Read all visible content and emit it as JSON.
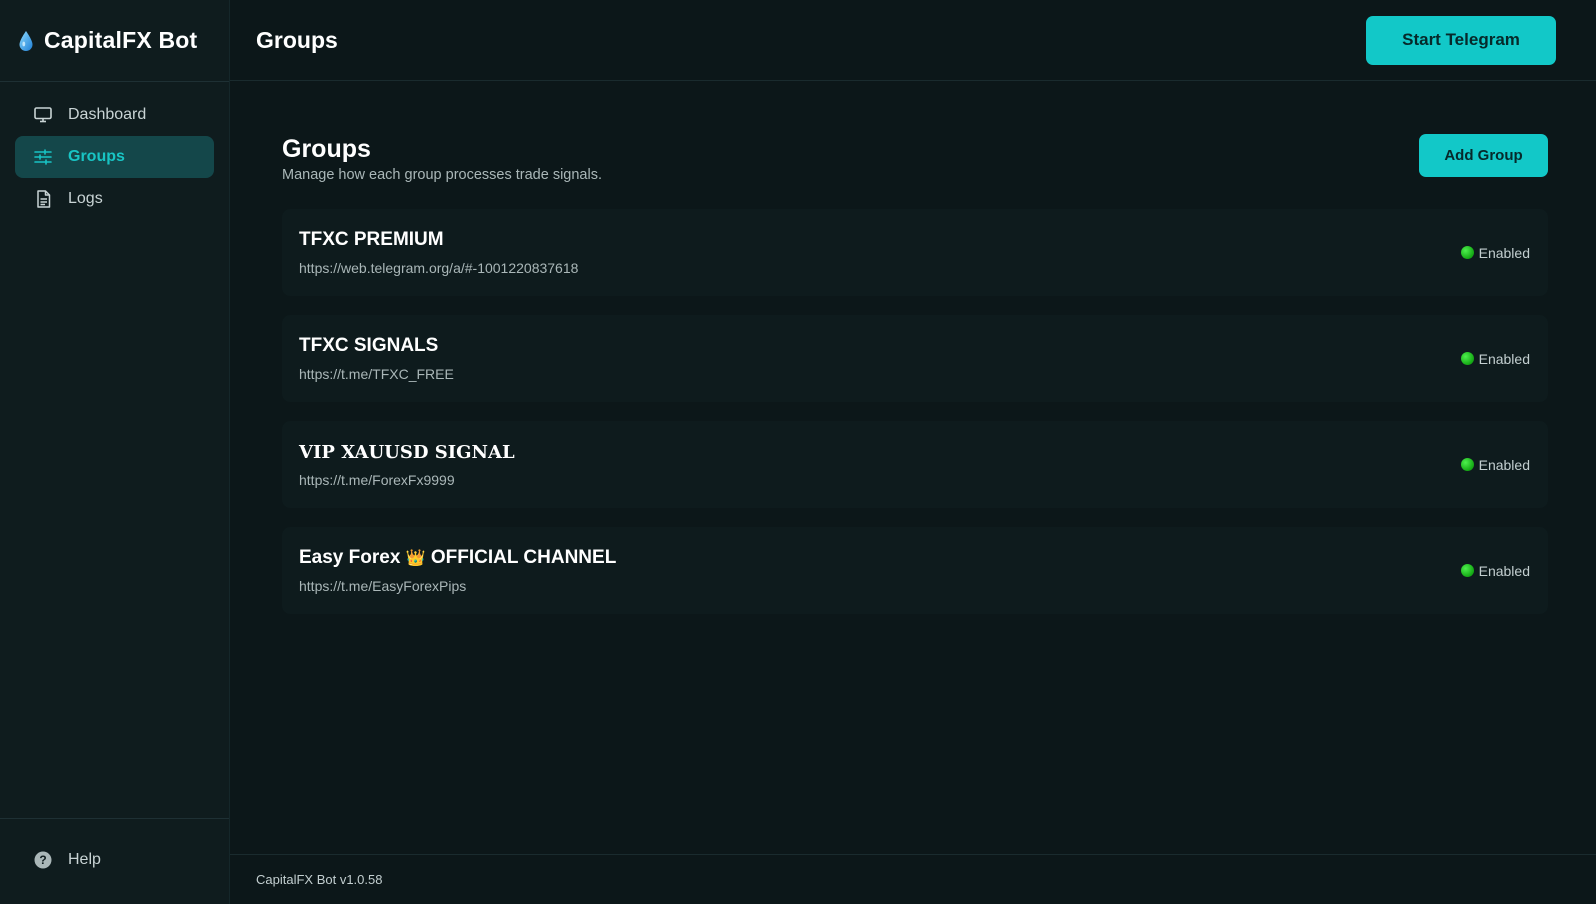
{
  "app": {
    "title": "CapitalFX Bot",
    "logo_icon": "water-drop-icon",
    "accent": "#12c8c8"
  },
  "sidebar": {
    "items": [
      {
        "label": "Dashboard",
        "icon": "monitor-icon",
        "active": false
      },
      {
        "label": "Groups",
        "icon": "sliders-icon",
        "active": true
      },
      {
        "label": "Logs",
        "icon": "document-icon",
        "active": false
      }
    ],
    "help": {
      "label": "Help",
      "icon": "question-circle-icon"
    }
  },
  "header": {
    "title": "Groups",
    "start_button": "Start Telegram"
  },
  "main": {
    "title": "Groups",
    "subtitle": "Manage how each group processes trade signals.",
    "add_button": "Add Group",
    "groups": [
      {
        "name": "TFXC PREMIUM",
        "url": "https://web.telegram.org/a/#-1001220837618",
        "status": "Enabled"
      },
      {
        "name": "TFXC SIGNALS",
        "url": "https://t.me/TFXC_FREE",
        "status": "Enabled"
      },
      {
        "name": "VIP XAUUSD SIGNAL",
        "url": "https://t.me/ForexFx9999",
        "status": "Enabled"
      },
      {
        "name_prefix": "Easy Forex",
        "name_emoji": "👑",
        "name_suffix": "OFFICIAL CHANNEL",
        "url": "https://t.me/EasyForexPips",
        "status": "Enabled"
      }
    ]
  },
  "footer": {
    "version": "CapitalFX Bot v1.0.58"
  },
  "colors": {
    "status_enabled": "#22c322",
    "active_nav_bg": "#14474a"
  }
}
